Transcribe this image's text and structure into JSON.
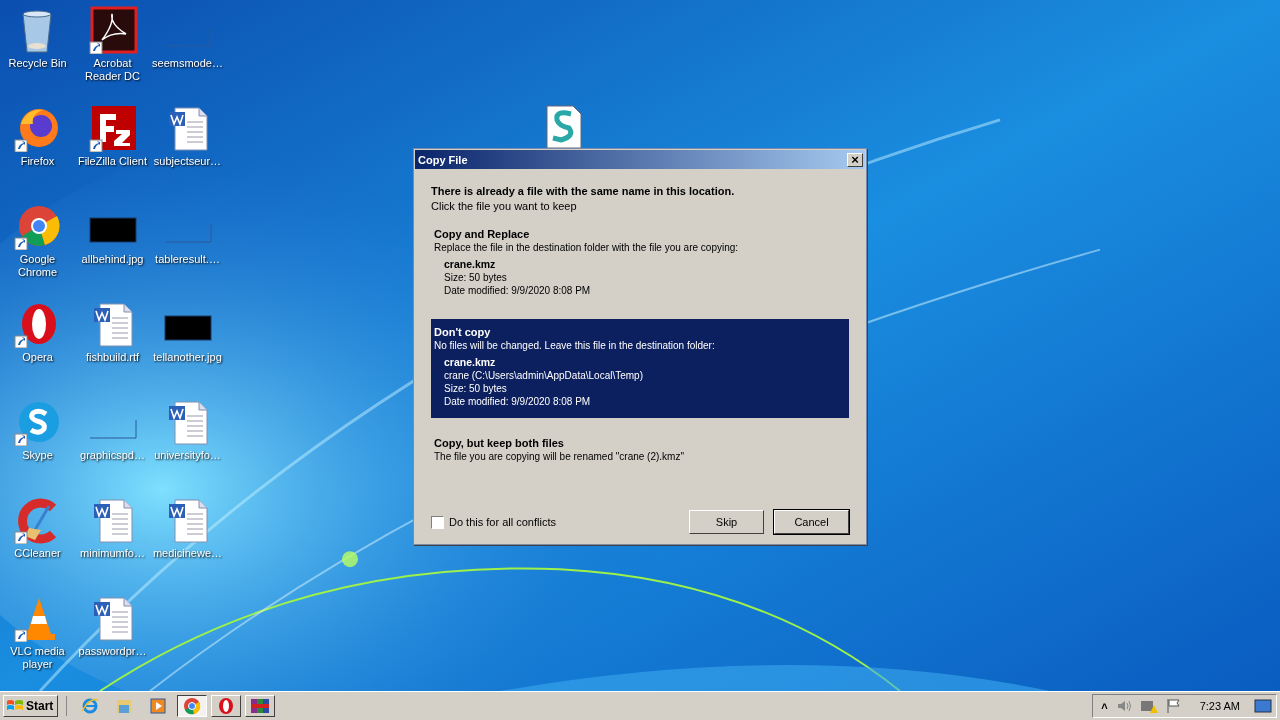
{
  "desktop_icons": [
    {
      "label": "Recycle Bin",
      "kind": "recycle"
    },
    {
      "label": "Firefox",
      "kind": "firefox",
      "shortcut": true
    },
    {
      "label": "Google Chrome",
      "kind": "chrome",
      "shortcut": true
    },
    {
      "label": "Opera",
      "kind": "opera",
      "shortcut": true
    },
    {
      "label": "Skype",
      "kind": "skype",
      "shortcut": true
    },
    {
      "label": "CCleaner",
      "kind": "ccleaner",
      "shortcut": true
    },
    {
      "label": "VLC media player",
      "kind": "vlc",
      "shortcut": true
    },
    {
      "label": "Acrobat Reader DC",
      "kind": "acrobat",
      "shortcut": true
    },
    {
      "label": "FileZilla Client",
      "kind": "filezilla",
      "shortcut": true
    },
    {
      "label": "allbehind.jpg",
      "kind": "dark-image"
    },
    {
      "label": "fishbuild.rtf",
      "kind": "word"
    },
    {
      "label": "graphicspd…",
      "kind": "blank"
    },
    {
      "label": "minimumfo…",
      "kind": "word"
    },
    {
      "label": "passwordpr…",
      "kind": "word"
    },
    {
      "label": "seemsmode…",
      "kind": "blank"
    },
    {
      "label": "subjectseur…",
      "kind": "word"
    },
    {
      "label": "tableresult.…",
      "kind": "blank"
    },
    {
      "label": "tellanother.jpg",
      "kind": "dark-image"
    },
    {
      "label": "universityfo…",
      "kind": "word"
    },
    {
      "label": "medicinewe…",
      "kind": "word"
    }
  ],
  "dragged_icon": {
    "kind": "script"
  },
  "dialog": {
    "title": "Copy File",
    "close": "×",
    "heading": "There is already a file with the same name in this location.",
    "subheading": "Click the file you want to keep",
    "options": [
      {
        "title": "Copy and Replace",
        "description": "Replace the file in the destination folder with the file you are copying:",
        "file_name": "crane.kmz",
        "details": [
          "Size: 50 bytes",
          "Date modified: 9/9/2020 8:08 PM"
        ],
        "selected": false
      },
      {
        "title": "Don't copy",
        "description": "No files will be changed. Leave this file in the destination folder:",
        "file_name": "crane.kmz",
        "details": [
          "crane (C:\\Users\\admin\\AppData\\Local\\Temp)",
          "Size: 50 bytes",
          "Date modified: 9/9/2020 8:08 PM"
        ],
        "selected": true
      },
      {
        "title": "Copy, but keep both files",
        "description": "The file you are copying will be renamed \"crane (2).kmz\"",
        "selected": false
      }
    ],
    "checkbox": {
      "label": "Do this for all conflicts",
      "checked": false
    },
    "buttons": [
      {
        "label": "Skip",
        "default": false
      },
      {
        "label": "Cancel",
        "default": true
      }
    ]
  },
  "taskbar": {
    "start": "Start",
    "quick_launch": [
      {
        "kind": "ie"
      },
      {
        "kind": "explorer"
      },
      {
        "kind": "media"
      }
    ],
    "tasks": [
      {
        "kind": "chrome",
        "selected": true
      },
      {
        "kind": "opera",
        "selected": false
      },
      {
        "kind": "winrar",
        "selected": false
      }
    ],
    "tray": {
      "chevron": "˄",
      "clock": "7:23 AM"
    }
  }
}
